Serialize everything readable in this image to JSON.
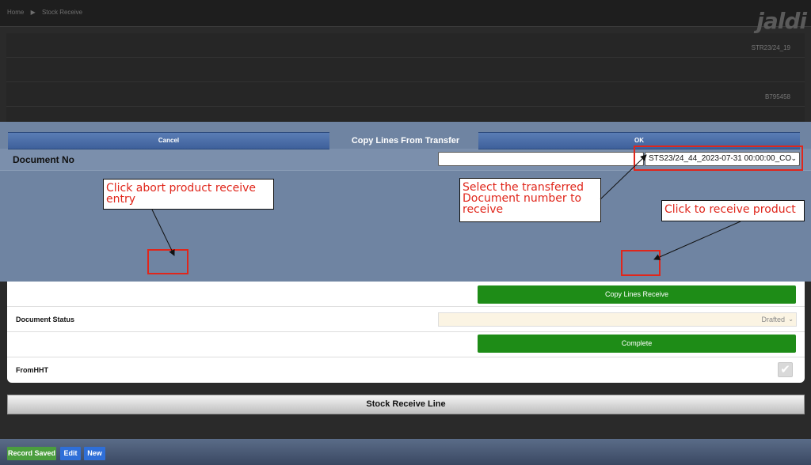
{
  "breadcrumb": {
    "home": "Home",
    "separator": "▶",
    "current": "Stock Receive"
  },
  "logo_text": "jaldi",
  "background_form": {
    "values": [
      "STR23/24_19",
      "",
      "B795458"
    ]
  },
  "modal": {
    "title": "Copy Lines From Transfer",
    "document_no_label": "Document No",
    "document_no_input": "",
    "document_select_value": "STS23/24_44_2023-07-31 00:00:00_CO",
    "cancel_label": "Cancel",
    "ok_label": "OK"
  },
  "annotations": {
    "abort": "Click abort product receive entry",
    "select_doc": "Select the transferred Document number to receive",
    "receive": "Click to receive product",
    "color": "#e0261b"
  },
  "form": {
    "copy_lines_label": "Copy Lines Receive",
    "document_status_label": "Document Status",
    "document_status_value": "Drafted",
    "complete_label": "Complete",
    "from_hht_label": "FromHHT",
    "from_hht_checked": true
  },
  "section_title": "Stock Receive Line",
  "footer": {
    "saved_label": "Record Saved",
    "edit_label": "Edit",
    "new_label": "New"
  }
}
